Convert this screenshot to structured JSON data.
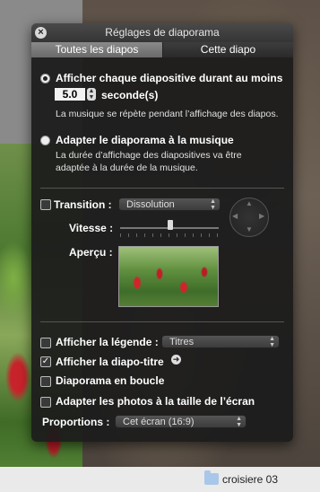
{
  "window": {
    "title": "Réglages de diaporama",
    "close_icon": "close-icon"
  },
  "tabs": [
    {
      "label": "Toutes les diapos",
      "selected": true
    },
    {
      "label": "Cette diapo",
      "selected": false
    }
  ],
  "timing": {
    "option1_label": "Afficher chaque diapositive durant au moins",
    "option1_selected": true,
    "seconds_value": "5.0",
    "seconds_unit": "seconde(s)",
    "option1_note": "La musique se répète pendant l’affichage des diapos.",
    "option2_label": "Adapter le diaporama à la musique",
    "option2_selected": false,
    "option2_note": "La durée d’affichage des diapositives va être adaptée à la durée de la musique."
  },
  "transition": {
    "label": "Transition :",
    "checked": false,
    "selected": "Dissolution",
    "speed_label": "Vitesse :",
    "speed_level": 0.5,
    "preview_label": "Aperçu :"
  },
  "options": {
    "legend_label": "Afficher la légende :",
    "legend_checked": false,
    "legend_value": "Titres",
    "title_slide_label": "Afficher la diapo-titre",
    "title_slide_checked": true,
    "loop_label": "Diaporama en boucle",
    "loop_checked": false,
    "fit_label": "Adapter les photos à la taille de l’écran",
    "fit_checked": false,
    "proportions_label": "Proportions :",
    "proportions_value": "Cet écran (16:9)"
  },
  "finder": {
    "folder_label": "croisiere 03",
    "folder_icon": "folder-icon"
  }
}
